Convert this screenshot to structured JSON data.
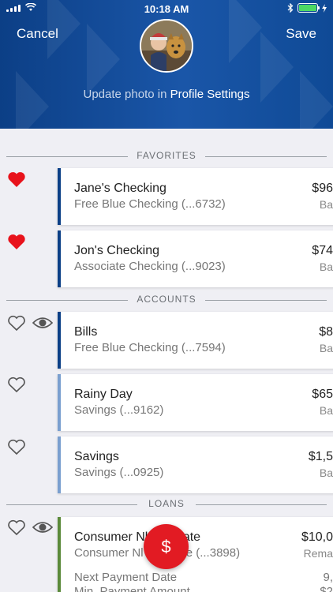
{
  "status": {
    "time": "10:18 AM"
  },
  "header": {
    "cancel": "Cancel",
    "save": "Save",
    "update_prefix": "Update photo in",
    "update_link": "Profile Settings"
  },
  "sections": {
    "favorites": "FAVORITES",
    "accounts": "ACCOUNTS",
    "loans": "LOANS"
  },
  "accounts": [
    {
      "name": "Jane's Checking",
      "sub": "Free Blue Checking (...6732)",
      "amount": "$96",
      "amount_label": "Ba"
    },
    {
      "name": "Jon's Checking",
      "sub": "Associate Checking (...9023)",
      "amount": "$74",
      "amount_label": "Ba"
    },
    {
      "name": "Bills",
      "sub": "Free Blue Checking (...7594)",
      "amount": "$8",
      "amount_label": "Ba"
    },
    {
      "name": "Rainy Day",
      "sub": "Savings (...9162)",
      "amount": "$65",
      "amount_label": "Ba"
    },
    {
      "name": "Savings",
      "sub": "Savings (...0925)",
      "amount": "$1,5",
      "amount_label": "Ba"
    },
    {
      "name": "Consumer Nl  al Estate",
      "sub": "Consumer Nl  al Estate (...3898)",
      "amount": "$10,0",
      "amount_label": "Rema",
      "detail1": "Next Payment Date",
      "detail1_value": "9,",
      "detail2": "Min. Payment Amount",
      "detail2_value": "$2"
    }
  ],
  "fab": {
    "label": "$"
  },
  "colors": {
    "header": "#0c3f86",
    "heart_filled": "#e8121b",
    "bar_dark": "#0b3f86",
    "bar_light": "#7a9fcf",
    "bar_loan": "#5b8a3a",
    "fab": "#e21b23"
  },
  "icons": {
    "heart_filled": "heart-filled-icon",
    "heart_outline": "heart-outline-icon",
    "eye": "eye-icon",
    "signal": "signal-icon",
    "wifi": "wifi-icon",
    "bluetooth": "bluetooth-icon",
    "battery": "battery-icon"
  }
}
